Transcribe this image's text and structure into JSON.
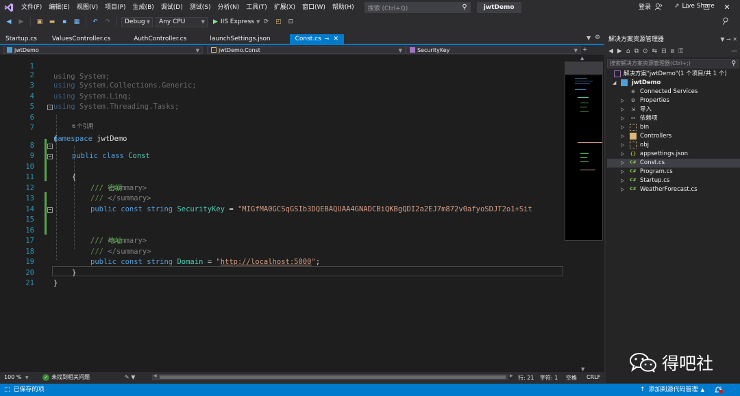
{
  "menu": {
    "items": [
      "文件(F)",
      "编辑(E)",
      "视图(V)",
      "项目(P)",
      "生成(B)",
      "调试(D)",
      "测试(S)",
      "分析(N)",
      "工具(T)",
      "扩展(X)",
      "窗口(W)",
      "帮助(H)"
    ],
    "search_placeholder": "搜索 (Ctrl+Q)",
    "solution_name": "jwtDemo",
    "login": "登录"
  },
  "toolbar": {
    "config": "Debug",
    "platform": "Any CPU",
    "run_target": "IIS Express",
    "live_share": "Live Share"
  },
  "tabs": [
    {
      "label": "Startup.cs",
      "active": false
    },
    {
      "label": "ValuesController.cs",
      "active": false
    },
    {
      "label": "AuthController.cs",
      "active": false
    },
    {
      "label": "launchSettings.json",
      "active": false
    },
    {
      "label": "Const.cs",
      "active": true
    }
  ],
  "navbar": {
    "project": "jwtDemo",
    "type": "jwtDemo.Const",
    "member": "SecurityKey"
  },
  "code": {
    "codelens": "6 个引用",
    "line1": "using System;",
    "line2_kw": "using",
    "line2_rest": " System.Collections.Generic;",
    "line3_kw": "using",
    "line3_rest": " System.Linq;",
    "line4_kw": "using",
    "line4_rest": " System.Threading.Tasks;",
    "ns_kw": "namespace",
    "ns_name": " jwtDemo",
    "open_brace": "{",
    "close_brace": "}",
    "class_kw1": "public",
    "class_kw2": "class",
    "class_name": "Const",
    "summary_open": "<summary>",
    "summary_close": "</summary>",
    "triple_slash": "///",
    "comment1": "密钥",
    "comment2": "地址",
    "public_kw": "public",
    "const_kw": "const",
    "string_kw": "string",
    "field1": "SecurityKey",
    "value1": "\"MIGfMA0GCSqGSIb3DQEBAQUAA4GNADCBiQKBgQDI2a2EJ7m872v0afyoSDJT2o1+Sit",
    "field2": "Domain",
    "value2_q1": "\"",
    "value2_link": "http://localhost:5000",
    "value2_q2": "\"",
    "equals": " = ",
    "semicolon": ";"
  },
  "line_numbers": [
    "1",
    "2",
    "3",
    "4",
    "5",
    "6",
    "7",
    "8",
    "9",
    "10",
    "11",
    "12",
    "13",
    "14",
    "15",
    "16",
    "17",
    "18",
    "19",
    "20",
    "21"
  ],
  "editor_status": {
    "zoom": "100 %",
    "issues": "未找到相关问题",
    "line": "行: 21",
    "char": "字符: 1",
    "space": "空格",
    "eol": "CRLF"
  },
  "solution_explorer": {
    "title": "解决方案资源管理器",
    "search_placeholder": "搜索解决方案资源管理器(Ctrl+;)",
    "items": [
      {
        "label": "解决方案\"jwtDemo\"(1 个项目/共 1 个)",
        "icon": "solution-icon"
      },
      {
        "label": "jwtDemo",
        "icon": "project-icon"
      },
      {
        "label": "Connected Services",
        "icon": "connected-services-icon"
      },
      {
        "label": "Properties",
        "icon": "properties-icon"
      },
      {
        "label": "导入",
        "icon": "import-icon"
      },
      {
        "label": "依赖项",
        "icon": "dependencies-icon"
      },
      {
        "label": "bin",
        "icon": "folder-icon"
      },
      {
        "label": "Controllers",
        "icon": "folder-icon"
      },
      {
        "label": "obj",
        "icon": "folder-icon"
      },
      {
        "label": "appsettings.json",
        "icon": "json-icon"
      },
      {
        "label": "Const.cs",
        "icon": "csharp-file-icon"
      },
      {
        "label": "Program.cs",
        "icon": "csharp-file-icon"
      },
      {
        "label": "Startup.cs",
        "icon": "csharp-file-icon"
      },
      {
        "label": "WeatherForecast.cs",
        "icon": "csharp-file-icon"
      }
    ]
  },
  "watermark": {
    "text": "得吧社"
  },
  "statusbar": {
    "left": "已保存的项",
    "right": "添加到源代码管理",
    "badge": "1"
  },
  "colors": {
    "accent": "#007acc",
    "keyword": "#569cd6",
    "type": "#4ec9b0",
    "comment": "#57a64a",
    "string": "#d69d85"
  }
}
